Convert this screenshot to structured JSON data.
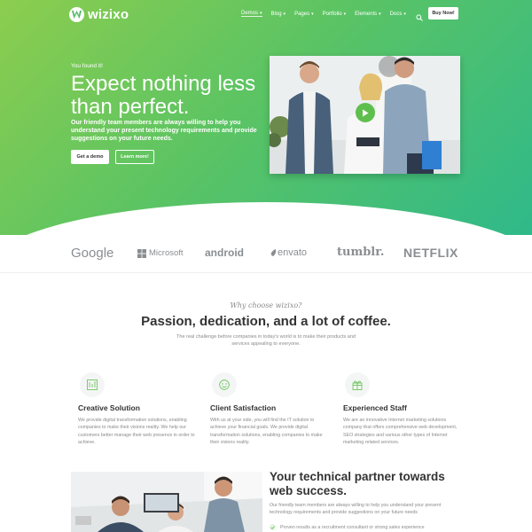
{
  "nav": {
    "brand": "wizixo",
    "items": [
      {
        "label": "Demos",
        "active": true
      },
      {
        "label": "Blog",
        "active": false
      },
      {
        "label": "Pages",
        "active": false
      },
      {
        "label": "Portfolio",
        "active": false
      },
      {
        "label": "Elements",
        "active": false
      },
      {
        "label": "Docs",
        "active": false
      }
    ],
    "chevron": "▾",
    "search_icon": "search-icon",
    "cta": "Buy Now!"
  },
  "hero": {
    "eyebrow": "You found it!",
    "title": "Expect nothing less than perfect.",
    "lead": "Our friendly team members are always willing to help you understand your present technology requirements and provide suggestions on your future needs.",
    "primary_button": "Get a demo",
    "secondary_button": "Learn more!",
    "play_icon": "play-icon"
  },
  "logos": [
    {
      "name": "Google"
    },
    {
      "name": "Microsoft"
    },
    {
      "name": "android"
    },
    {
      "name": "envato"
    },
    {
      "name": "tumblr."
    },
    {
      "name": "NETFLIX"
    }
  ],
  "why": {
    "eyebrow": "Why choose wizixo?",
    "title": "Passion, dedication, and a lot of coffee.",
    "subtitle": "The real challenge before companies in today's world is to make their products and services appealing to everyone."
  },
  "features": [
    {
      "icon": "design-icon",
      "title": "Creative Solution",
      "desc": "We provide digital transformation solutions, enabling companies to make their visions reality. We help our customers better manage their web presence in order to achieve."
    },
    {
      "icon": "smile-icon",
      "title": "Client Satisfaction",
      "desc": "With us at your side, you will find the IT solution to achieve your financial goals. We provide digital transformation solutions, enabling companies to make their visions reality."
    },
    {
      "icon": "gift-icon",
      "title": "Experienced Staff",
      "desc": "We are an innovative Internet marketing solutions company that offers comprehensive web development, SEO strategies and various other types of Internet marketing related services."
    }
  ],
  "partner": {
    "title": "Your technical partner towards web success.",
    "desc": "Our friendly team members are always willing to help you understand your present technology requirements and provide suggestions on your future needs",
    "bullet": "Proven results as a recruitment consultant or strong sales experience"
  },
  "colors": {
    "brand_green": "#5fbf4e",
    "gradient_start": "#8ccd4e",
    "gradient_end": "#2fb98a"
  }
}
